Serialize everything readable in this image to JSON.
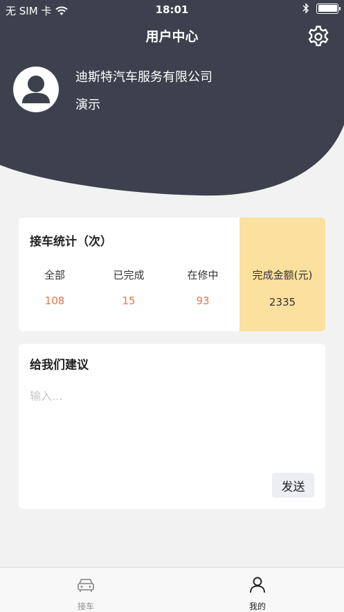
{
  "status_bar": {
    "carrier": "无 SIM 卡",
    "time": "18:01"
  },
  "header": {
    "title": "用户中心",
    "company": "迪斯特汽车服务有限公司",
    "username": "演示"
  },
  "stats": {
    "title": "接车统计（次）",
    "items": [
      {
        "label": "全部",
        "value": "108"
      },
      {
        "label": "已完成",
        "value": "15"
      },
      {
        "label": "在修中",
        "value": "93"
      }
    ],
    "amount": {
      "label": "完成金额(元)",
      "value": "2335"
    }
  },
  "suggestion": {
    "title": "给我们建议",
    "placeholder": "输入...",
    "send_label": "发送"
  },
  "tabbar": {
    "items": [
      {
        "label": "接车",
        "icon": "car-icon",
        "active": false
      },
      {
        "label": "我的",
        "icon": "user-icon",
        "active": true
      }
    ]
  },
  "colors": {
    "header_bg": "#3c414d",
    "accent_value": "#e8754a",
    "amount_bg": "#fce09e",
    "page_bg": "#f2f2f2"
  }
}
